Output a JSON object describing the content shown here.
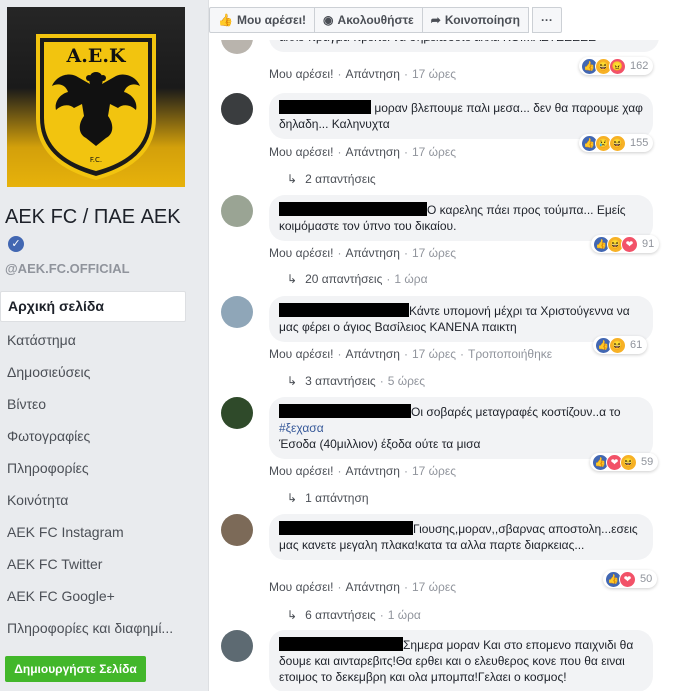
{
  "sidebar": {
    "page_name": "AEK FC / ΠΑΕ AEK",
    "handle": "@AEK.FC.OFFICIAL",
    "crest_text": "Α.Ε.Κ",
    "crest_sub": "F.C.",
    "nav": [
      "Αρχική σελίδα",
      "Κατάστημα",
      "Δημοσιεύσεις",
      "Βίντεο",
      "Φωτογραφίες",
      "Πληροφορίες",
      "Κοινότητα",
      "AEK FC Instagram",
      "AEK FC Twitter",
      "AEK FC Google+",
      "Πληροφορίες και διαφημί..."
    ],
    "create_page": "Δημιουργήστε Σελίδα"
  },
  "actionbar": {
    "like": "Μου αρέσει!",
    "follow": "Ακολουθήστε",
    "share": "Κοινοποίηση",
    "more": "···"
  },
  "labels": {
    "like": "Μου αρέσει!",
    "reply": "Απάντηση",
    "edited": "Τροποποιήθηκε",
    "dot": "·"
  },
  "comments": [
    {
      "text": "αλλο πραγμα πρεπει να σημειωσετε αλλα ΚΟΙΜΑΣΤΕΕΕΕΕ",
      "time": "17 ώρες",
      "reaction_count": "162"
    },
    {
      "text": " μοραν βλεπουμε παλι μεσα... δεν θα παρουμε χαφ δηλαδη... Καληνυχτα",
      "time": "17 ώρες",
      "reaction_count": "155",
      "replies": "2 απαντήσεις"
    },
    {
      "text": "Ο καρελης πάει προς τούμπα... Εμείς κοιμόμαστε τον ύπνο του δικαίου.",
      "time": "17 ώρες",
      "reaction_count": "91",
      "replies": "20 απαντήσεις",
      "replies_time": "1 ώρα"
    },
    {
      "text": "Κάντε υπομονή μέχρι τα Χριστούγεννα να μας φέρει ο άγιος Βασίλειος ΚΑΝΕΝΑ παικτη",
      "time": "17 ώρες",
      "reaction_count": "61",
      "replies": "3 απαντήσεις",
      "replies_time": "5 ώρες"
    },
    {
      "text": "Οι σοβαρές μεταγραφές κοστίζουν..α το",
      "hashtag": "#ξεχασα",
      "text2": "Έσοδα (40μιλλιον) έξοδα ούτε τα μισα",
      "time": "17 ώρες",
      "reaction_count": "59",
      "replies": "1 απάντηση"
    },
    {
      "text": "Γιουσης,μοραν,,σβαρνας αποστολη...εσεις μας κανετε μεγαλη πλακα!κατα τα αλλα παρτε διαρκειας...",
      "time": "17 ώρες",
      "reaction_count": "50",
      "replies": "6 απαντήσεις",
      "replies_time": "1 ώρα"
    },
    {
      "text": "Σημερα μοραν Και στο επομενο παιχνιδι θα δουμε και αινταρεβιτς!Θα ερθει και ο ελευθερος κονε που θα ειναι ετοιμος το δεκεμβρη και ολα μπομπα!Γελαει ο κοσμος!"
    }
  ]
}
